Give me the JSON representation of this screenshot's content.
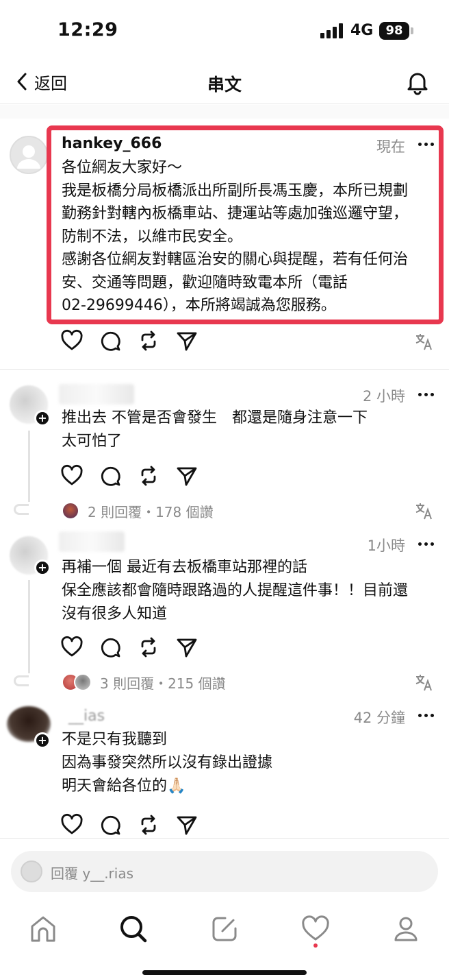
{
  "status_bar": {
    "time": "12:29",
    "network": "4G",
    "battery": "98"
  },
  "nav": {
    "back_label": "返回",
    "title": "串文"
  },
  "post": {
    "username": "hankey_666",
    "timestamp": "現在",
    "lines": [
      "各位網友大家好～",
      "我是板橋分局板橋派出所副所長馮玉慶，本所已規劃",
      "勤務針對轄內板橋車站、捷運站等處加強巡邏守望，",
      "防制不法，以維市民安全。",
      "感謝各位網友對轄區治安的關心與提醒，若有任何治",
      "安、交通等問題，歡迎隨時致電本所（電話",
      "02-29699446），本所將竭誠為您服務。"
    ],
    "highlight_color": "#e8384f"
  },
  "comments": [
    {
      "timestamp": "2 小時",
      "lines": [
        "推出去 不管是否會發生　都還是隨身注意一下",
        "太可怕了"
      ],
      "reply_summary": "2 則回覆・178 個讚"
    },
    {
      "timestamp": "1小時",
      "lines": [
        "再補一個 最近有去板橋車站那裡的話",
        "保全應該都會隨時跟路過的人提醒這件事！！目前還",
        "沒有很多人知道"
      ],
      "reply_summary": "3 則回覆・215 個讚"
    },
    {
      "name_fragment": "__ias",
      "timestamp": "42 分鐘",
      "lines": [
        "不是只有我聽到",
        "因為事發突然所以沒有錄出證據",
        "明天會給各位的🙏🏻"
      ]
    }
  ],
  "reply_input": {
    "placeholder": "回覆 y__.rias"
  },
  "icons": {
    "actions": [
      "heart-icon",
      "comment-icon",
      "repost-icon",
      "share-icon",
      "translate-icon"
    ],
    "tabs": [
      "home-icon",
      "search-icon",
      "compose-icon",
      "activity-icon",
      "profile-icon"
    ]
  },
  "colors": {
    "accent": "#e8384f",
    "muted": "#8a8a8a",
    "text": "#111111"
  }
}
